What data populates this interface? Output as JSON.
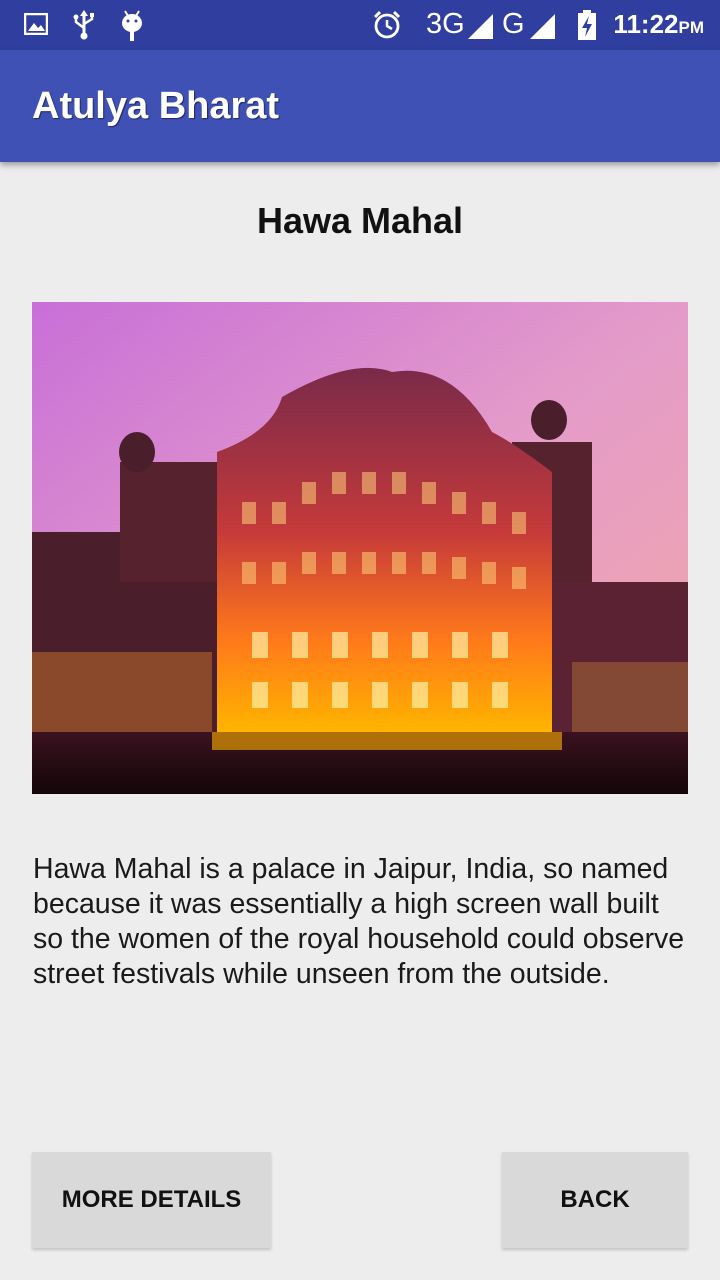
{
  "status_bar": {
    "time": "11:22",
    "ampm": "PM",
    "network_1": "3G",
    "network_2": "G",
    "icons": [
      "image-icon",
      "usb-icon",
      "android-debug-icon",
      "alarm-icon",
      "signal-icon",
      "signal-icon",
      "battery-charging-icon"
    ]
  },
  "app_bar": {
    "title": "Atulya Bharat"
  },
  "place": {
    "title": "Hawa Mahal",
    "image_subject": "Hawa Mahal palace illuminated at dusk",
    "description": "Hawa Mahal is a palace in Jaipur, India, so named because it was essentially a high screen wall built so the women of the royal household could observe street festivals while unseen from the outside."
  },
  "buttons": {
    "more_details": "MORE DETAILS",
    "back": "BACK"
  },
  "colors": {
    "status_bar": "#303f9f",
    "app_bar": "#3f51b5",
    "background": "#ededed",
    "button": "#d9d9d9"
  }
}
